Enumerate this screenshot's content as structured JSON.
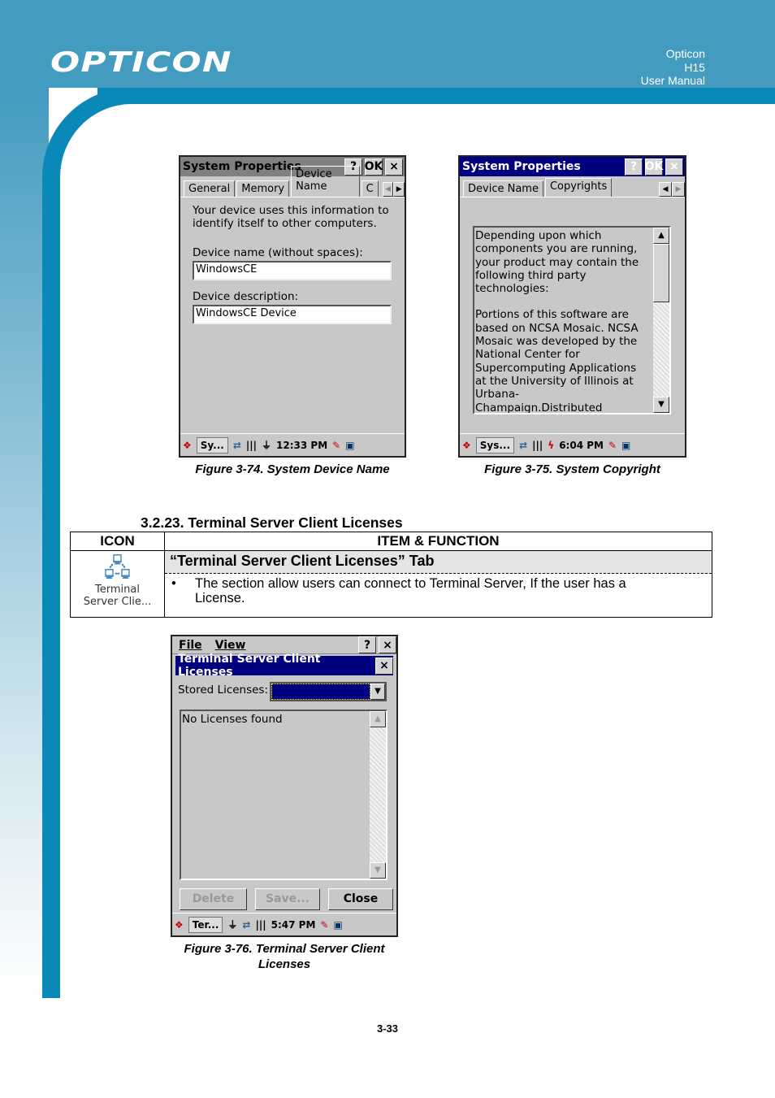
{
  "header": {
    "logo": "OPTICON",
    "meta": [
      "Opticon",
      "H15",
      "User Manual"
    ]
  },
  "fig74": {
    "title": "System Properties",
    "help": "?",
    "ok": "OK",
    "close": "×",
    "tabs": [
      "General",
      "Memory",
      "Device Name",
      "C"
    ],
    "intro": "Your device uses this information to identify itself to other computers.",
    "name_label": "Device name (without spaces):",
    "name_value": "WindowsCE",
    "desc_label": "Device description:",
    "desc_value": "WindowsCE Device",
    "task": "Sy...",
    "time": "12:33 PM",
    "caption": "Figure 3-74. System Device Name"
  },
  "fig75": {
    "title": "System Properties",
    "help": "?",
    "ok": "OK",
    "close": "×",
    "tabs": [
      "Device Name",
      "Copyrights"
    ],
    "text1": "Depending upon which components you are running, your product may contain the following third party technologies:",
    "text2": "Portions of this software are based on NCSA Mosaic. NCSA Mosaic was developed by the National Center for Supercomputing Applications at the University of Illinois at Urbana-Champaign.Distributed",
    "task": "Sys...",
    "time": "6:04 PM",
    "caption": "Figure 3-75. System Copyright"
  },
  "section": {
    "heading": "3.2.23. Terminal Server Client Licenses",
    "col_icon": "ICON",
    "col_func": "ITEM & FUNCTION",
    "icon_label": "Terminal Server Clie...",
    "tab_title": "“Terminal Server Client Licenses” Tab",
    "bullet": "The section allow users can connect to Terminal Server, If the user has a License."
  },
  "fig76": {
    "menu": [
      "File",
      "View"
    ],
    "help": "?",
    "close": "×",
    "title": "Terminal Server Client Licenses",
    "stored_label": "Stored Licenses:",
    "list_text": "No Licenses found",
    "buttons": [
      "Delete",
      "Save...",
      "Close"
    ],
    "task": "Ter...",
    "time": "5:47 PM",
    "caption": "Figure 3-76. Terminal Server Client Licenses"
  },
  "page_number": "3-33",
  "colors": {
    "header": "#439bc0",
    "band": "#0a89b9",
    "titlebar_active": "#000080"
  }
}
